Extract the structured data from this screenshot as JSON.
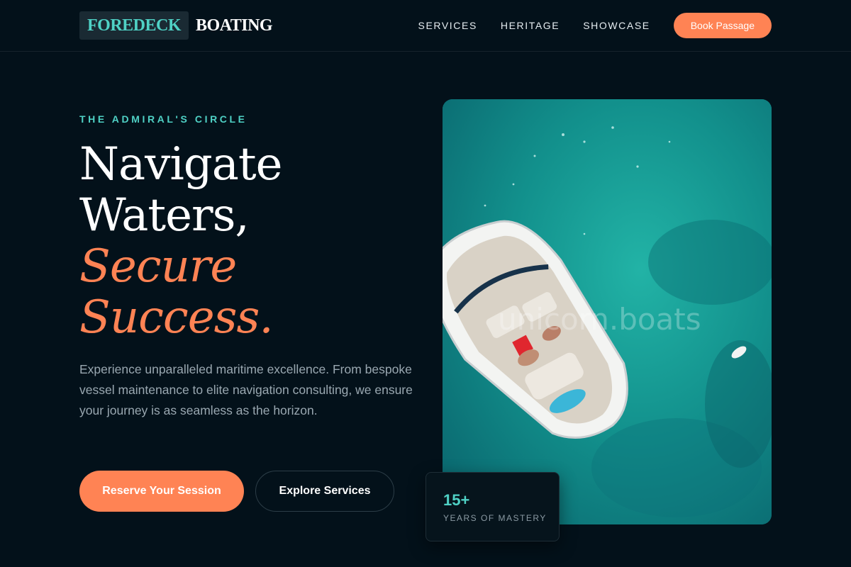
{
  "brand": {
    "name_highlight": "FOREDECK",
    "name_rest": "BOATING",
    "highlight_color": "#4fd1c5"
  },
  "nav": {
    "items": [
      {
        "label": "SERVICES"
      },
      {
        "label": "HERITAGE"
      },
      {
        "label": "SHOWCASE"
      }
    ],
    "cta_label": "Book Passage"
  },
  "hero": {
    "eyebrow": "THE ADMIRAL'S CIRCLE",
    "headline_line1": "Navigate",
    "headline_line2": "Waters,",
    "headline_accent_line1": "Secure",
    "headline_accent_line2": "Success.",
    "description": "Experience unparalleled maritime excellence. From bespoke vessel maintenance to elite navigation consulting, we ensure your journey is as seamless as the horizon.",
    "primary_cta": "Reserve Your Session",
    "secondary_cta": "Explore Services",
    "image_watermark": "unicorn.boats"
  },
  "stat": {
    "value": "15+",
    "label": "YEARS OF MASTERY"
  },
  "colors": {
    "background": "#03111a",
    "accent_orange": "#ff8354",
    "accent_teal": "#4fd1c5",
    "muted_text": "#9aa8b1"
  }
}
